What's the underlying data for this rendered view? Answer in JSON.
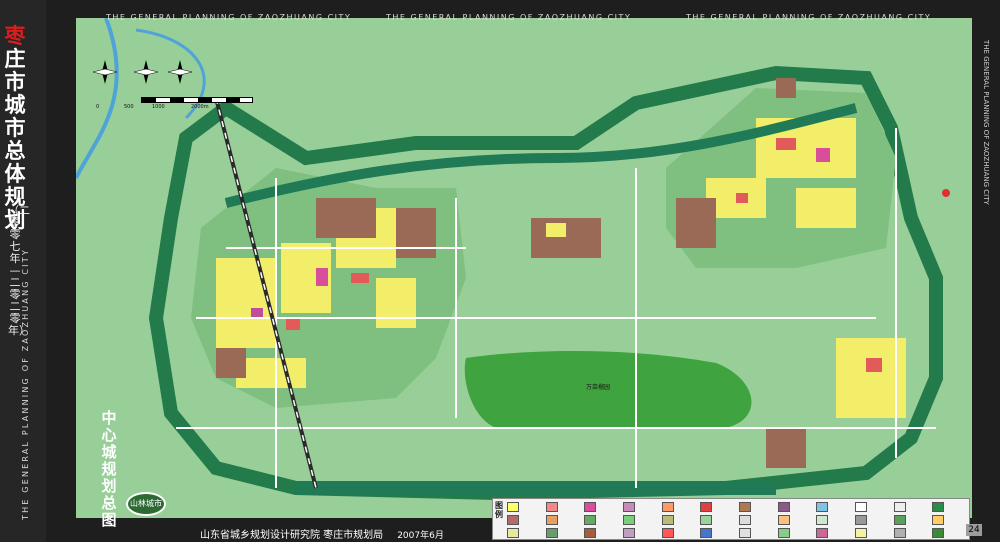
{
  "title": {
    "first_char": "枣",
    "rest": "庄市城市总体规划",
    "years": "（二零零七年—二零二零年）",
    "english": "THE GENERAL PLANNING OF ZAOZHUANG CITY"
  },
  "top_headings": [
    "THE GENERAL PLANNING OF ZAOZHUANG CITY",
    "THE GENERAL PLANNING OF ZAOZHUANG CITY",
    "THE GENERAL PLANNING OF ZAOZHUANG CITY"
  ],
  "right_heading": "THE GENERAL PLANNING OF ZAOZHUANG CITY",
  "section_title": "中心城规划总图",
  "stamp": "山林城市",
  "footer": {
    "institutes": "山东省城乡规划设计研究院  枣庄市规划局",
    "date": "2007年6月"
  },
  "page_number": "24",
  "legend": {
    "label": "图例",
    "swatch_colors": [
      "#ffff66",
      "#f08a8a",
      "#d94e9b",
      "#c88ab8",
      "#ff9966",
      "#e04040",
      "#b07850",
      "#8a5a8a",
      "#7dc4e8",
      "#ffffff",
      "#eeeeee",
      "#2b8c4a",
      "#b76a6a",
      "#e8a060",
      "#66aa66",
      "#7bcf7b",
      "#bbbb77",
      "#9bd19b",
      "#dddddd",
      "#f9c080",
      "#cfe6cf",
      "#999999",
      "#5aa05a",
      "#ffcc66",
      "#e8e8a0",
      "#6a9b6a",
      "#a06040",
      "#c0a0c0",
      "#ff5555",
      "#4477cc",
      "#e0e0e0",
      "#88cc88",
      "#cc6699",
      "#f4f4a0",
      "#b0b0b0",
      "#3a8a3a"
    ]
  },
  "compass_labels": [
    "N"
  ],
  "scale_labels": [
    "0",
    "500",
    "1000",
    "2000m"
  ],
  "map_labels": [
    "万亩榴园"
  ],
  "colors": {
    "land": "#8dc88d",
    "green_belt": "#2b8c55",
    "forest": "#44aa44",
    "residential": "#f5f16a",
    "commercial": "#e85a5a",
    "industrial": "#9a6a56",
    "water": "#4fa3d8",
    "road": "#ffffff",
    "railway": "#3a3a3a",
    "scenic": "#a3d9a3"
  }
}
